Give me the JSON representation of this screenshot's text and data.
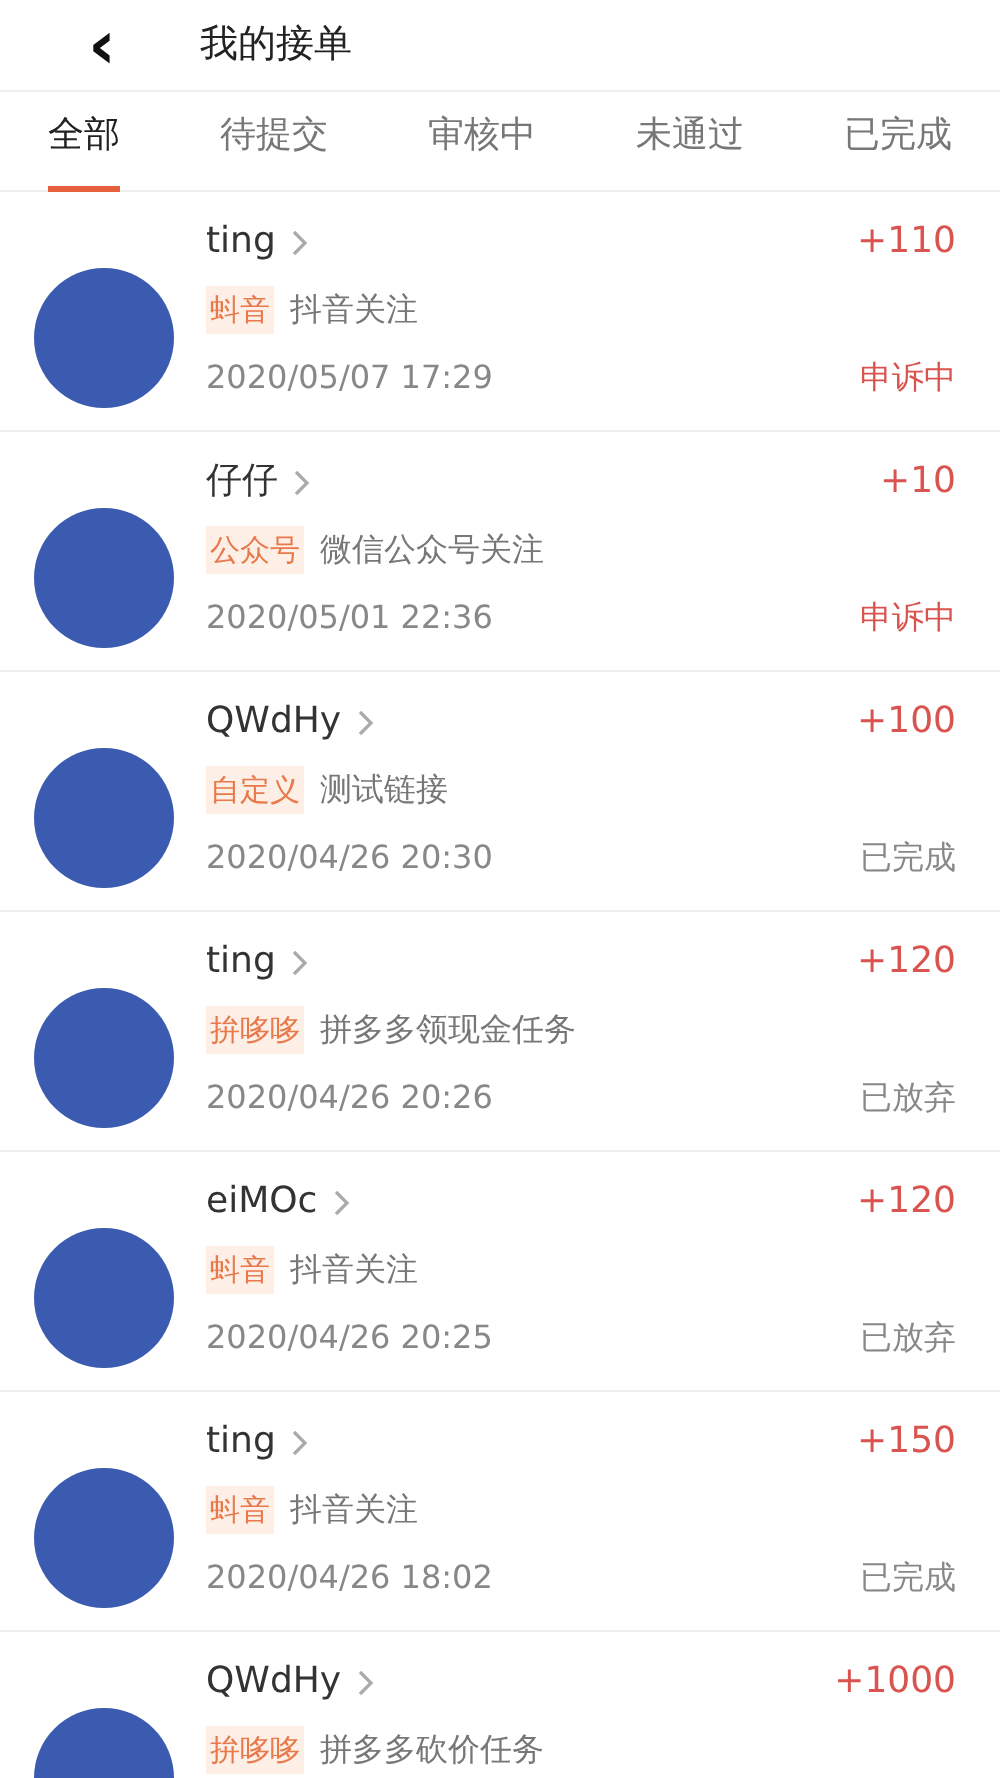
{
  "header": {
    "back_icon": "‹",
    "title": "我的接单"
  },
  "tabs": [
    {
      "label": "全部",
      "selected": true
    },
    {
      "label": "待提交",
      "selected": false
    },
    {
      "label": "审核中",
      "selected": false
    },
    {
      "label": "未通过",
      "selected": false
    },
    {
      "label": "已完成",
      "selected": false
    }
  ],
  "orders": [
    {
      "user": "ting",
      "tag": "蚪音",
      "task": "抖音关注",
      "reward": "+110",
      "time": "2020/05/07 17:29",
      "status": "申诉中",
      "alert": true
    },
    {
      "user": "仔仔",
      "tag": "公众号",
      "task": "微信公众号关注",
      "reward": "+10",
      "time": "2020/05/01 22:36",
      "status": "申诉中",
      "alert": true
    },
    {
      "user": "QWdHy",
      "tag": "自定义",
      "task": "测试链接",
      "reward": "+100",
      "time": "2020/04/26 20:30",
      "status": "已完成",
      "alert": false
    },
    {
      "user": "ting",
      "tag": "拚哆哆",
      "task": "拼多多领现金任务",
      "reward": "+120",
      "time": "2020/04/26 20:26",
      "status": "已放弃",
      "alert": false
    },
    {
      "user": "eiMOc",
      "tag": "蚪音",
      "task": "抖音关注",
      "reward": "+120",
      "time": "2020/04/26 20:25",
      "status": "已放弃",
      "alert": false
    },
    {
      "user": "ting",
      "tag": "蚪音",
      "task": "抖音关注",
      "reward": "+150",
      "time": "2020/04/26 18:02",
      "status": "已完成",
      "alert": false
    },
    {
      "user": "QWdHy",
      "tag": "拚哆哆",
      "task": "拼多多砍价任务",
      "reward": "+1000"
    }
  ]
}
